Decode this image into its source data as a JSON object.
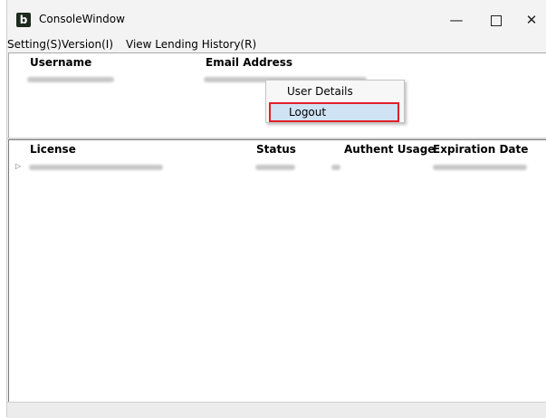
{
  "window": {
    "title": "ConsoleWindow",
    "logo_letter": "b",
    "controls": {
      "minimize": "—",
      "close": "✕"
    }
  },
  "menu": {
    "setting": "Setting(S)",
    "version": "Version(I)",
    "history": "View Lending History(R)"
  },
  "user_table": {
    "columns": [
      "Username",
      "Email Address"
    ]
  },
  "license_table": {
    "columns": [
      "License",
      "Status",
      "Authent Usage",
      "Expiration Date"
    ],
    "expander": "▷"
  },
  "context_menu": {
    "items": [
      "User Details",
      "Logout"
    ]
  },
  "colors": {
    "highlight_border": "#e0202a",
    "selected_bg": "#cfe3f4"
  }
}
